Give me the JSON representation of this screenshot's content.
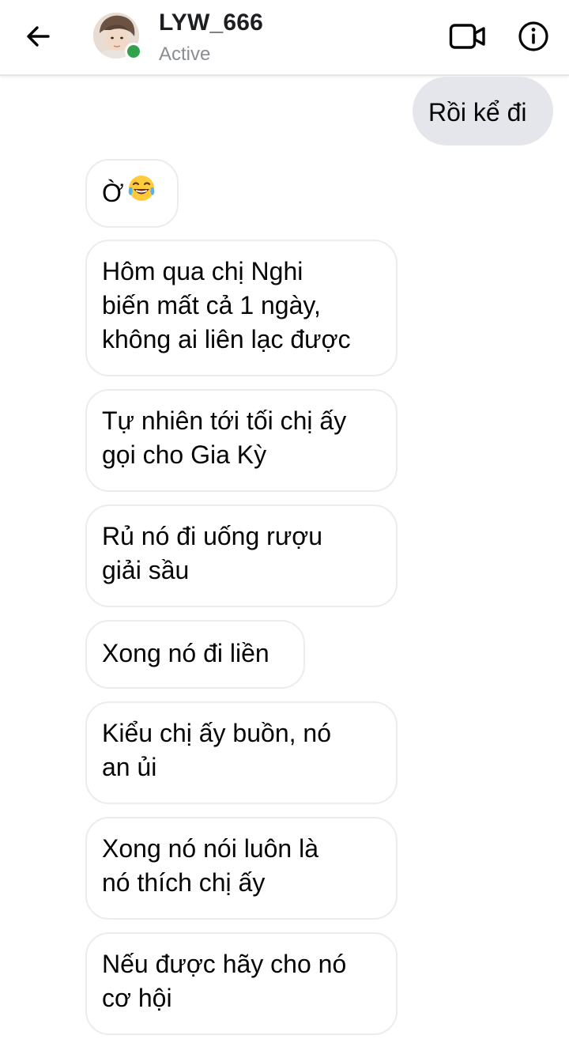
{
  "header": {
    "contact_name": "LYW_666",
    "status": "Active",
    "back_icon": "arrow-left-icon",
    "video_icon": "video-camera-icon",
    "info_icon": "info-icon",
    "online_color": "#31a24c"
  },
  "messages": {
    "out_0": "Rồi kể đi",
    "in_0": {
      "text": "Ờ",
      "emoji": "😂"
    },
    "in_1": [
      "Hôm qua chị Nghi",
      "biến mất cả 1 ngày,",
      "không ai liên lạc được"
    ],
    "in_2": [
      "Tự nhiên tới tối chị ấy",
      "gọi cho Gia Kỳ"
    ],
    "in_3": [
      "Rủ nó đi uống rượu",
      "giải sầu"
    ],
    "in_4": [
      "Xong nó đi liền"
    ],
    "in_5": [
      "Kiểu chị ấy buồn, nó",
      "an ủi"
    ],
    "in_6": [
      "Xong nó nói luôn là",
      "nó thích chị ấy"
    ],
    "in_7": [
      "Nếu được hãy cho nó",
      "cơ hội"
    ]
  },
  "colors": {
    "outgoing_bubble": "#e4e6eb",
    "incoming_border": "#ececec"
  }
}
